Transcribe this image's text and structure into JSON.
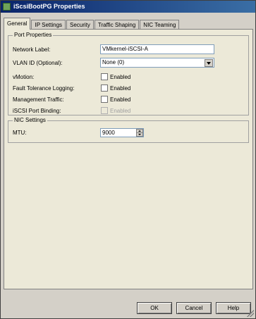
{
  "window": {
    "title": "iScsiBootPG Properties"
  },
  "tabs": [
    {
      "label": "General",
      "active": true
    },
    {
      "label": "IP Settings",
      "active": false
    },
    {
      "label": "Security",
      "active": false
    },
    {
      "label": "Traffic Shaping",
      "active": false
    },
    {
      "label": "NIC Teaming",
      "active": false
    }
  ],
  "port_properties": {
    "legend": "Port Properties",
    "network_label": {
      "label": "Network Label:",
      "value": "VMkernel-iSCSI-A"
    },
    "vlan_id": {
      "label": "VLAN ID (Optional):",
      "value": "None (0)"
    },
    "vmotion": {
      "label": "vMotion:",
      "checkbox_label": "Enabled",
      "checked": false
    },
    "fault_tolerance": {
      "label": "Fault Tolerance Logging:",
      "checkbox_label": "Enabled",
      "checked": false
    },
    "management": {
      "label": "Management Traffic:",
      "checkbox_label": "Enabled",
      "checked": false
    },
    "iscsi_binding": {
      "label": "iSCSI Port Binding:",
      "checkbox_label": "Enabled",
      "checked": false,
      "disabled": true
    }
  },
  "nic_settings": {
    "legend": "NIC Settings",
    "mtu": {
      "label": "MTU:",
      "value": "9000"
    }
  },
  "buttons": {
    "ok": "OK",
    "cancel": "Cancel",
    "help": "Help"
  }
}
